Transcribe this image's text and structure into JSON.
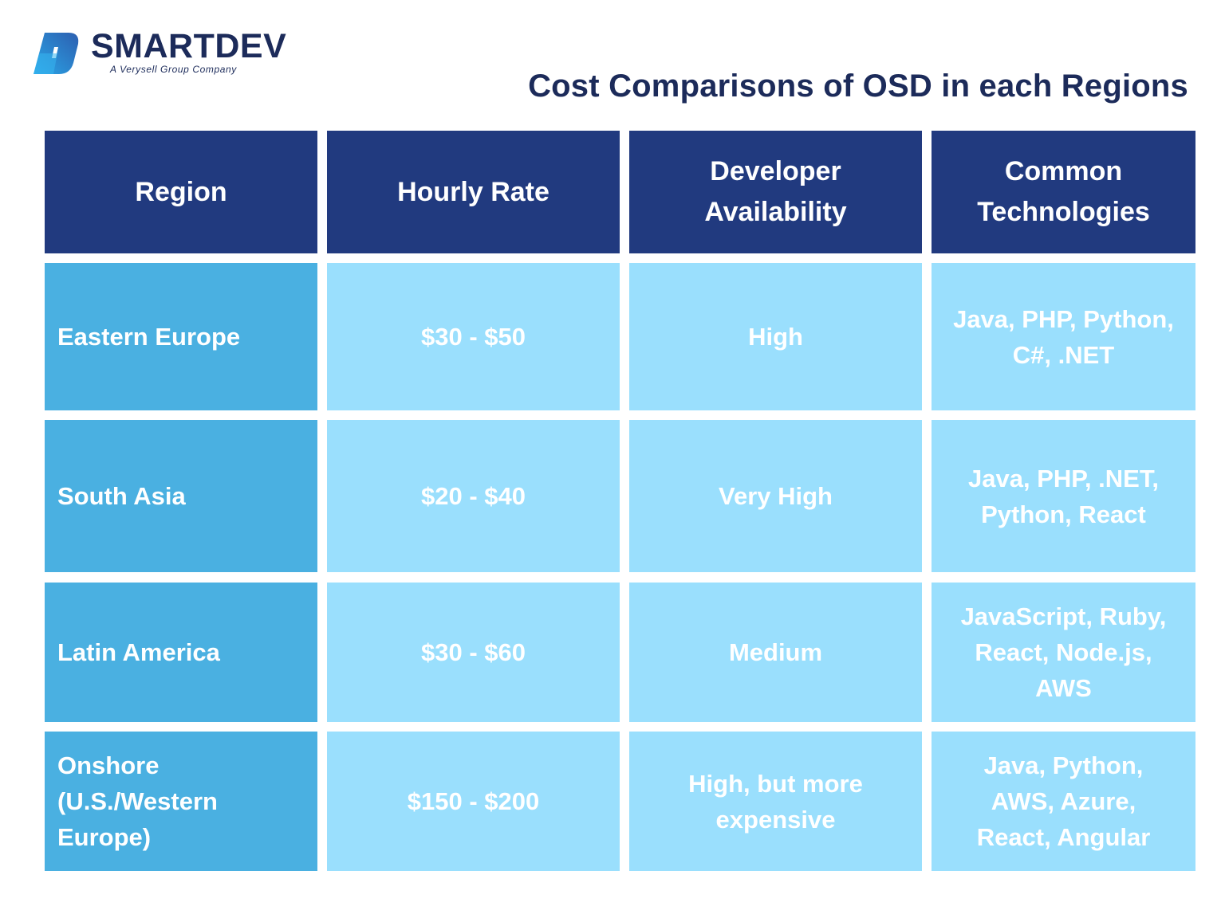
{
  "brand": {
    "name": "SMARTDEV",
    "tagline": "A Verysell Group Company",
    "colors": {
      "navy": "#1c2b5a",
      "header_bg": "#213a7f",
      "region_bg": "#4ab0e1",
      "cell_bg": "#9adffd"
    }
  },
  "title": "Cost Comparisons of OSD in each Regions",
  "table": {
    "headers": [
      "Region",
      "Hourly Rate",
      "Developer\nAvailability",
      "Common\nTechnologies"
    ],
    "rows": [
      {
        "region": "Eastern Europe",
        "rate": "$30 - $50",
        "availability": "High",
        "technologies": "Java, PHP, Python,\nC#, .NET"
      },
      {
        "region": "South Asia",
        "rate": "$20 - $40",
        "availability": "Very High",
        "technologies": "Java, PHP, .NET,\nPython, React"
      },
      {
        "region": "Latin America",
        "rate": "$30 - $60",
        "availability": "Medium",
        "technologies": "JavaScript, Ruby,\nReact, Node.js,\nAWS"
      },
      {
        "region": "Onshore\n(U.S./Western\nEurope)",
        "rate": "$150 - $200",
        "availability": "High, but more\nexpensive",
        "technologies": "Java, Python,\nAWS, Azure,\nReact, Angular"
      }
    ]
  }
}
